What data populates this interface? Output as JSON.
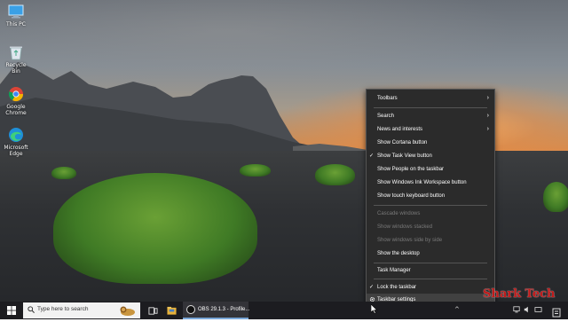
{
  "desktop": {
    "icons": [
      {
        "label": "This PC",
        "icon": "this-pc-icon"
      },
      {
        "label": "Recycle Bin",
        "icon": "recycle-bin-icon"
      },
      {
        "label": "Google Chrome",
        "icon": "chrome-icon"
      },
      {
        "label": "Microsoft Edge",
        "icon": "edge-icon"
      }
    ]
  },
  "context_menu": {
    "items": {
      "toolbars": {
        "label": "Toolbars",
        "has_submenu": true
      },
      "search": {
        "label": "Search",
        "has_submenu": true
      },
      "news": {
        "label": "News and interests",
        "has_submenu": true
      },
      "cortana": {
        "label": "Show Cortana button"
      },
      "task_view": {
        "label": "Show Task View button",
        "checked": true
      },
      "people": {
        "label": "Show People on the taskbar"
      },
      "ink": {
        "label": "Show Windows Ink Workspace button"
      },
      "touch_keyboard": {
        "label": "Show touch keyboard button"
      },
      "cascade": {
        "label": "Cascade windows",
        "disabled": true
      },
      "stacked": {
        "label": "Show windows stacked",
        "disabled": true
      },
      "side_by_side": {
        "label": "Show windows side by side",
        "disabled": true
      },
      "desktop": {
        "label": "Show the desktop"
      },
      "task_manager": {
        "label": "Task Manager"
      },
      "lock": {
        "label": "Lock the taskbar",
        "checked": true
      },
      "settings": {
        "label": "Taskbar settings",
        "icon": "gear-icon"
      }
    },
    "check_glyph": "✓",
    "arrow_glyph": "›"
  },
  "taskbar": {
    "search_placeholder": "Type here to search",
    "obs_label": "OBS 29.1.3 - Profile...",
    "colors": {
      "background": "#1c1c20",
      "accent": "#7aa7d8"
    }
  },
  "watermark": "Shark Tech"
}
